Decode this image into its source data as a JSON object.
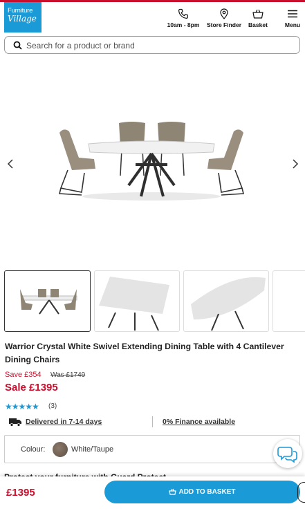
{
  "header": {
    "logo_line1": "Furniture",
    "logo_line2": "Village",
    "nav": {
      "hours_label": "10am - 8pm",
      "store_finder_label": "Store Finder",
      "basket_label": "Basket",
      "menu_label": "Menu"
    }
  },
  "search": {
    "placeholder": "Search for a product or brand"
  },
  "gallery": {
    "icons": [
      "chevron-left-icon",
      "chevron-right-icon"
    ],
    "thumbnail_count_visible": 4
  },
  "product": {
    "title": "Warrior Crystal White Swivel Extending Dining Table with 4 Cantilever Dining Chairs",
    "save_text": "Save £354",
    "was_text": "Was £1749",
    "sale_text": "Sale £1395",
    "rating_stars": "★★★★★",
    "rating_value": 5,
    "review_count": "(3)",
    "delivery_text": "Delivered in 7-14 days",
    "finance_text": "0% Finance available",
    "colour_label": "Colour:",
    "colour_value": "White/Taupe",
    "partial_text": "Protect your furniture with Guard Protect"
  },
  "footer": {
    "price": "£1395",
    "add_button_label": "ADD TO BASKET"
  },
  "colors": {
    "brand_blue": "#1a9ad6",
    "sale_red": "#c8102e"
  }
}
